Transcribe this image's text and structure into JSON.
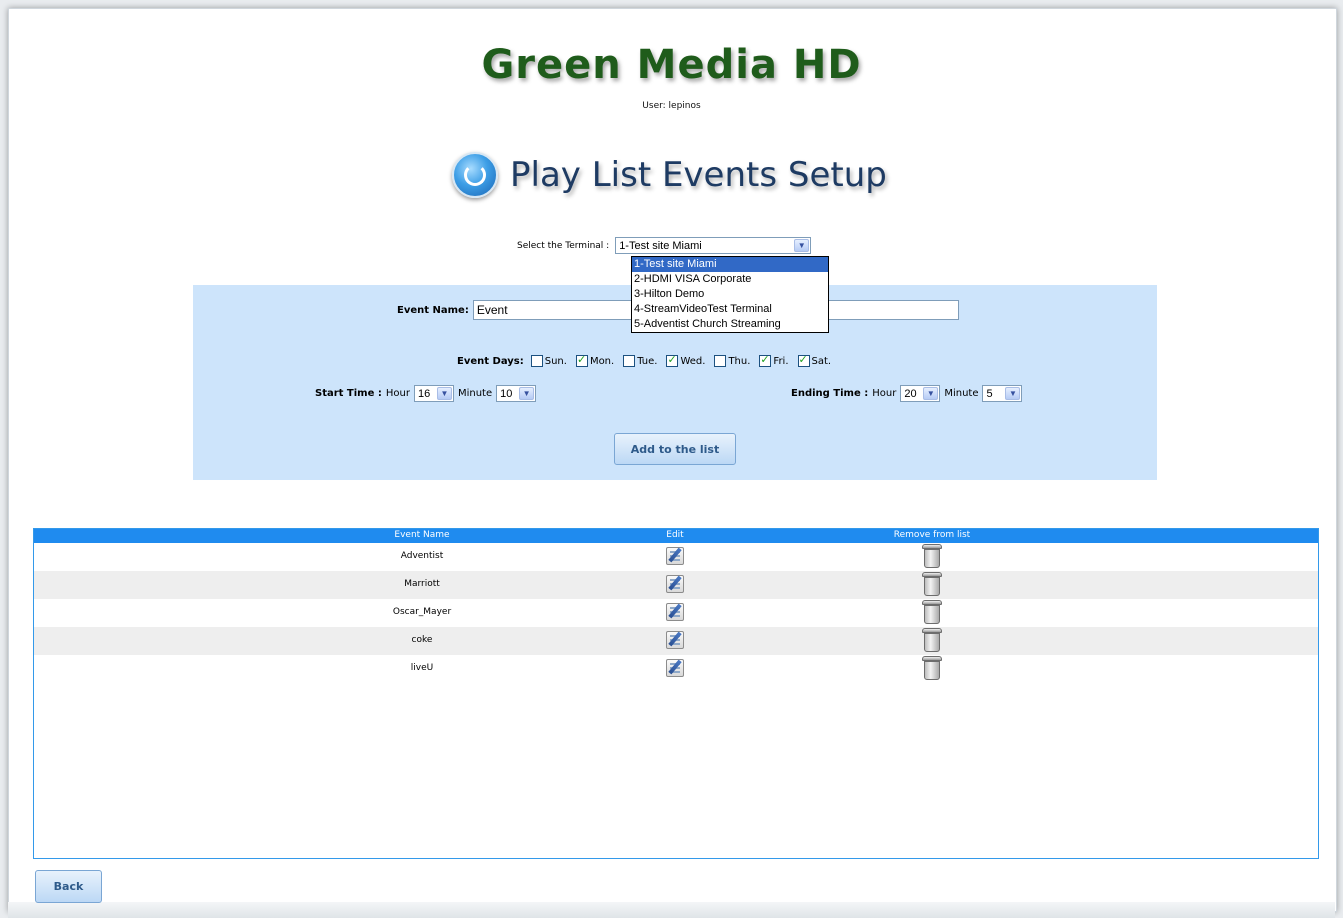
{
  "header": {
    "logo_text": "Green Media HD",
    "user_text": "User: lepinos",
    "page_title": "Play List Events Setup",
    "title_icon": "refresh-icon"
  },
  "terminal": {
    "label": "Select the Terminal :",
    "selected": "1-Test site Miami",
    "options": [
      "1-Test site Miami",
      "2-HDMI VISA Corporate",
      "3-Hilton Demo",
      "4-StreamVideoTest Terminal",
      "5-Adventist Church Streaming"
    ],
    "dropdown_open": true
  },
  "form": {
    "event_name_label": "Event Name:",
    "event_name_value": "Event",
    "event_days_label": "Event Days:",
    "days": [
      {
        "label": "Sun.",
        "checked": false
      },
      {
        "label": "Mon.",
        "checked": true
      },
      {
        "label": "Tue.",
        "checked": false
      },
      {
        "label": "Wed.",
        "checked": true
      },
      {
        "label": "Thu.",
        "checked": false
      },
      {
        "label": "Fri.",
        "checked": true
      },
      {
        "label": "Sat.",
        "checked": true
      }
    ],
    "start_time_label": "Start Time :",
    "ending_time_label": "Ending Time :",
    "hour_label": "Hour",
    "minute_label": "Minute",
    "start_hour": "16",
    "start_minute": "10",
    "end_hour": "20",
    "end_minute": "5",
    "add_button": "Add to the list",
    "panel_color": "#cde4fb"
  },
  "table": {
    "columns": [
      "Event Name",
      "Edit",
      "Remove from list"
    ],
    "rows": [
      {
        "name": "Adventist"
      },
      {
        "name": "Marriott"
      },
      {
        "name": "Oscar_Mayer"
      },
      {
        "name": "coke"
      },
      {
        "name": "liveU"
      }
    ],
    "edit_icon": "edit-icon",
    "remove_icon": "trash-icon",
    "header_color": "#1f8bef"
  },
  "footer": {
    "back_button": "Back"
  }
}
